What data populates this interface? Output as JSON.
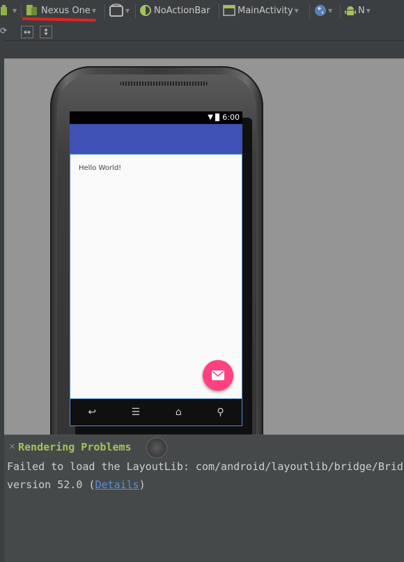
{
  "toolbar": {
    "device_label": "Nexus One",
    "theme_label": "NoActionBar",
    "activity_label": "MainActivity",
    "api_label": "N"
  },
  "device": {
    "status_time": "6:00",
    "hello_text": "Hello World!",
    "appbar_color": "#3f51b5",
    "fab_color": "#ff4081"
  },
  "problems": {
    "title": "Rendering Problems",
    "message_line1": "Failed to load the LayoutLib: com/android/layoutlib/bridge/Brid",
    "message_line2_prefix": "version 52.0 (",
    "details_link": "Details",
    "message_line2_suffix": ")"
  },
  "colors": {
    "annotation_red": "#e32222",
    "ide_background": "#3c3f41",
    "canvas_background": "#959595"
  }
}
